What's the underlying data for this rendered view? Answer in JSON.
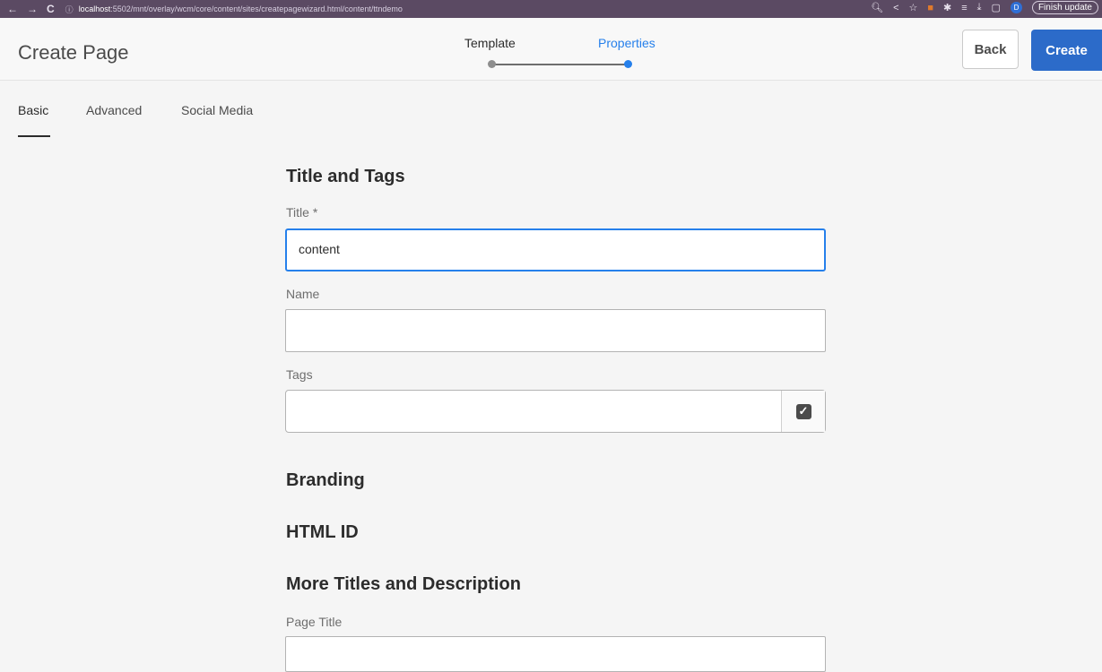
{
  "browser": {
    "back_icon": "←",
    "forward_icon": "→",
    "reload_icon": "C",
    "info_icon": "ⓘ",
    "url_host": "localhost",
    "url_rest": ":5502/mnt/overlay/wcm/core/content/sites/createpagewizard.html/content/ttndemo",
    "profile_initial": "D",
    "update_label": "Finish update"
  },
  "header": {
    "title": "Create Page",
    "steps": [
      {
        "label": "Template",
        "state": "done"
      },
      {
        "label": "Properties",
        "state": "active"
      }
    ],
    "back_label": "Back",
    "create_label": "Create"
  },
  "tabs": [
    "Basic",
    "Advanced",
    "Social Media"
  ],
  "active_tab": "Basic",
  "form": {
    "section_title_tags": "Title and Tags",
    "title_label": "Title *",
    "title_value": "content",
    "name_label": "Name",
    "name_value": "",
    "tags_label": "Tags",
    "tags_value": "",
    "section_branding": "Branding",
    "section_html_id": "HTML ID",
    "section_more": "More Titles and Description",
    "page_title_label": "Page Title",
    "page_title_value": ""
  },
  "colors": {
    "accent": "#2680eb",
    "create_button": "#2c6bc9",
    "browser_bar": "#5b4a63"
  }
}
